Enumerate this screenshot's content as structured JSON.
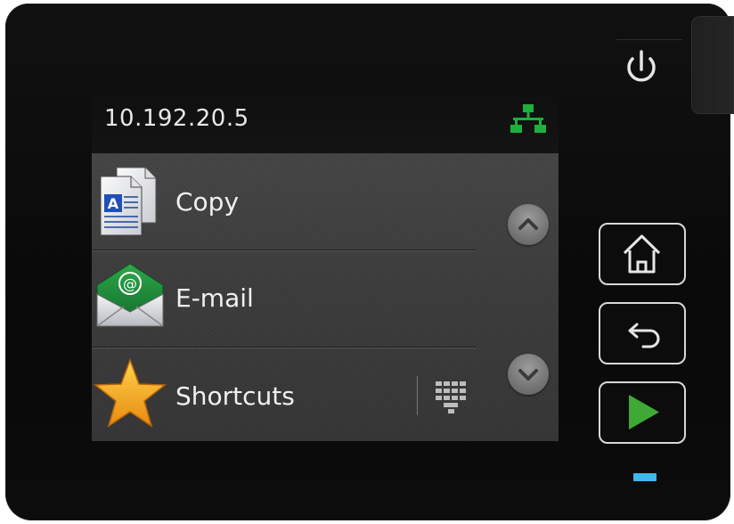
{
  "status_bar": {
    "ip_address": "10.192.20.5",
    "network_icon": "wired-network-icon",
    "network_color": "#1db03c"
  },
  "menu": {
    "items": [
      {
        "label": "Copy",
        "icon": "copy-document-icon"
      },
      {
        "label": "E-mail",
        "icon": "email-envelope-icon"
      },
      {
        "label": "Shortcuts",
        "icon": "star-icon"
      }
    ],
    "scroll_up_icon": "chevron-up-icon",
    "scroll_down_icon": "chevron-down-icon",
    "keypad_icon": "keypad-icon"
  },
  "hardware_buttons": {
    "power_icon": "power-icon",
    "home_icon": "home-icon",
    "back_icon": "back-arrow-icon",
    "start_icon": "start-play-icon",
    "start_color": "#3fa935"
  },
  "indicator": {
    "led_color": "#3fb8ea"
  }
}
